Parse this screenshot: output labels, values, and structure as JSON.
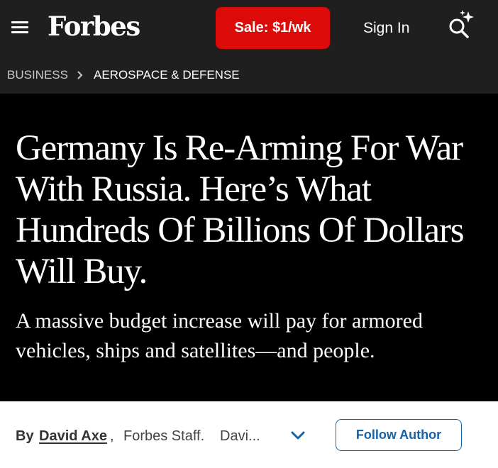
{
  "header": {
    "logo": "Forbes",
    "sale_label": "Sale: $1/wk",
    "signin_label": "Sign In",
    "icons": [
      "menu-icon",
      "search-sparkle-icon"
    ]
  },
  "breadcrumb": {
    "items": [
      "BUSINESS",
      "AEROSPACE & DEFENSE"
    ],
    "separator_icon": "chevron-right-icon"
  },
  "article": {
    "headline": "Germany Is Re-Arming For War With Russia. Here’s What Hundreds Of Billions Of Dollars Will Buy.",
    "dek": "A massive budget increase will pay for armored vehicles, ships and satellites—and people."
  },
  "byline": {
    "by_label": "By",
    "author": "David Axe",
    "comma": ",",
    "staff": "Forbes Staff.",
    "truncated": "Davi...",
    "expand_icon": "chevron-down-icon",
    "follow_label": "Follow Author"
  },
  "colors": {
    "topbar_bg": "#1f1f1f",
    "hero_bg": "#000000",
    "sale_red": "#dd0a0a",
    "follow_blue": "#1662a8"
  }
}
